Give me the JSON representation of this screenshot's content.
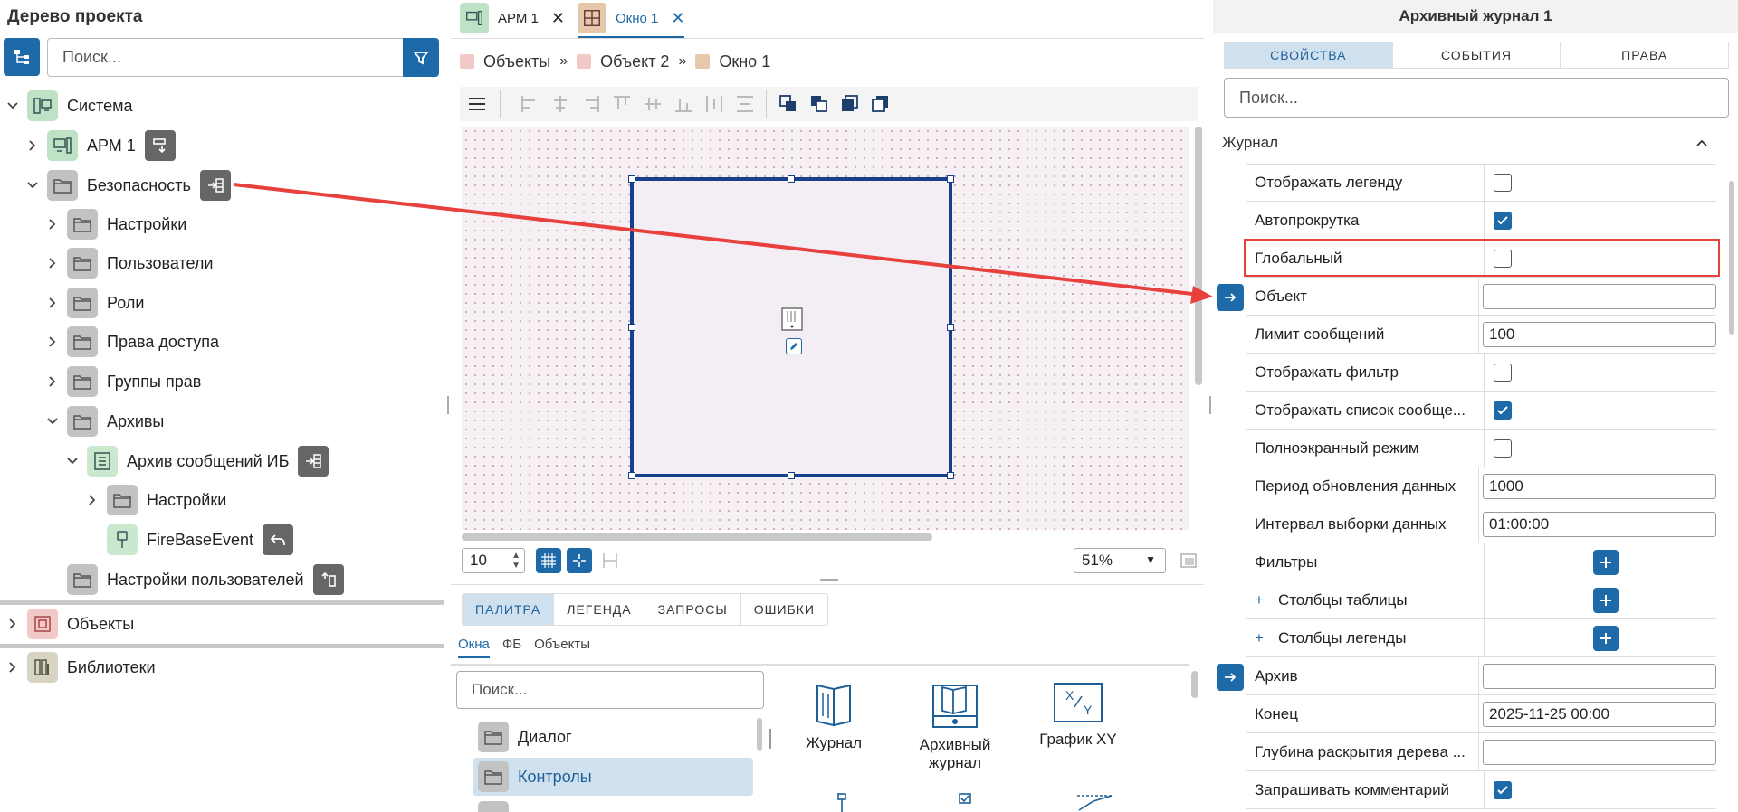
{
  "left_panel": {
    "title": "Дерево проекта",
    "search_placeholder": "Поиск...",
    "tree": {
      "system": "Система",
      "arm": "АРМ 1",
      "security": "Безопасность",
      "settings": "Настройки",
      "users": "Пользователи",
      "roles": "Роли",
      "access": "Права доступа",
      "groups": "Группы прав",
      "archives": "Архивы",
      "ib_archive": "Архив сообщений ИБ",
      "ib_settings": "Настройки",
      "firebase": "FireBaseEvent",
      "user_settings": "Настройки пользователей",
      "objects": "Объекты",
      "libraries": "Библиотеки"
    }
  },
  "center": {
    "tabs": [
      {
        "label": "АРМ 1"
      },
      {
        "label": "Окно 1"
      }
    ],
    "breadcrumb": [
      "Объекты",
      "Объект 2",
      "Окно 1"
    ],
    "grid_size": "10",
    "zoom": "51%",
    "bottom_tabs": [
      "ПАЛИТРА",
      "ЛЕГЕНДА",
      "ЗАПРОСЫ",
      "ОШИБКИ"
    ],
    "sub_tabs": [
      "Окна",
      "ФБ",
      "Объекты"
    ],
    "palette_search_placeholder": "Поиск...",
    "palette_items": [
      "Диалог",
      "Контролы"
    ],
    "components": [
      {
        "label": "Журнал"
      },
      {
        "label": "Архивный журнал"
      },
      {
        "label": "График XY"
      }
    ]
  },
  "right_panel": {
    "title": "Архивный журнал 1",
    "tabs": [
      "СВОЙСТВА",
      "СОБЫТИЯ",
      "ПРАВА"
    ],
    "search_placeholder": "Поиск...",
    "group": "Журнал",
    "props": [
      {
        "name": "Отображать легенду",
        "type": "checkbox",
        "checked": false
      },
      {
        "name": "Автопрокрутка",
        "type": "checkbox",
        "checked": true
      },
      {
        "name": "Глобальный",
        "type": "checkbox",
        "checked": false
      },
      {
        "name": "Объект",
        "type": "input",
        "value": ""
      },
      {
        "name": "Лимит сообщений",
        "type": "input",
        "value": "100"
      },
      {
        "name": "Отображать фильтр",
        "type": "checkbox",
        "checked": false
      },
      {
        "name": "Отображать список сообще...",
        "type": "checkbox",
        "checked": true
      },
      {
        "name": "Полноэкранный режим",
        "type": "checkbox",
        "checked": false
      },
      {
        "name": "Период обновления данных",
        "type": "input",
        "value": "1000"
      },
      {
        "name": "Интервал выборки данных",
        "type": "input",
        "value": "01:00:00"
      },
      {
        "name": "Фильтры",
        "type": "add"
      },
      {
        "name": "Столбцы таблицы",
        "type": "add"
      },
      {
        "name": "Столбцы легенды",
        "type": "add"
      },
      {
        "name": "Архив",
        "type": "input",
        "value": ""
      },
      {
        "name": "Конец",
        "type": "input",
        "value": "2025-11-25 00:00"
      },
      {
        "name": "Глубина раскрытия дерева ...",
        "type": "input",
        "value": ""
      },
      {
        "name": "Запрашивать комментарий",
        "type": "checkbox",
        "checked": true
      }
    ]
  },
  "colors": {
    "accent": "#1e6aa8",
    "selection_frame": "#163f8c",
    "annotation_red": "#e8403c"
  }
}
